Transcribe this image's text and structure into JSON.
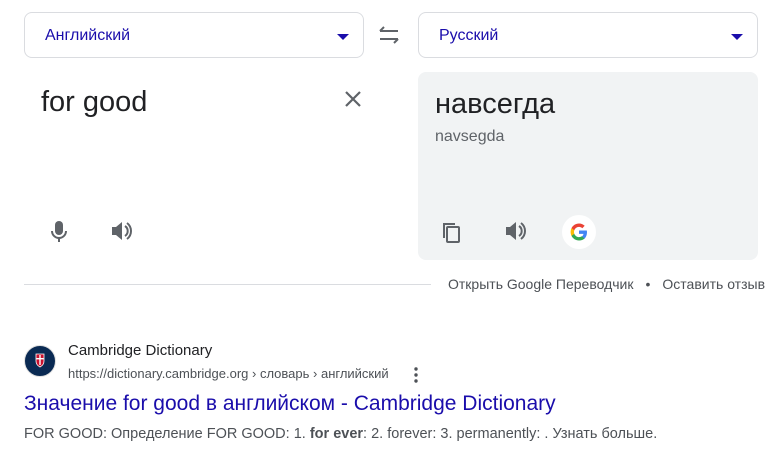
{
  "source_lang": "Английский",
  "target_lang": "Русский",
  "source_text": "for good",
  "target_text": "навсегда",
  "transliteration": "navsegda",
  "footer": {
    "open_translate": "Открыть Google Переводчик",
    "separator": "•",
    "feedback": "Оставить отзыв"
  },
  "result": {
    "site_name": "Cambridge Dictionary",
    "url": "https://dictionary.cambridge.org › словарь › английский",
    "title": "Значение for good в английском - Cambridge Dictionary",
    "snippet_1": "FOR GOOD: Определение FOR GOOD: 1. ",
    "snippet_bold": "for ever",
    "snippet_2": ": 2. forever: 3. permanently: . Узнать больше."
  },
  "colors": {
    "link": "#1a0dab",
    "panel": "#f1f3f4",
    "text_secondary": "#4d5156"
  },
  "icons": [
    "chevron-down-icon",
    "swap-icon",
    "close-icon",
    "microphone-icon",
    "speaker-icon",
    "copy-icon",
    "google-g-icon",
    "more-vert-icon",
    "cambridge-crest-icon"
  ]
}
